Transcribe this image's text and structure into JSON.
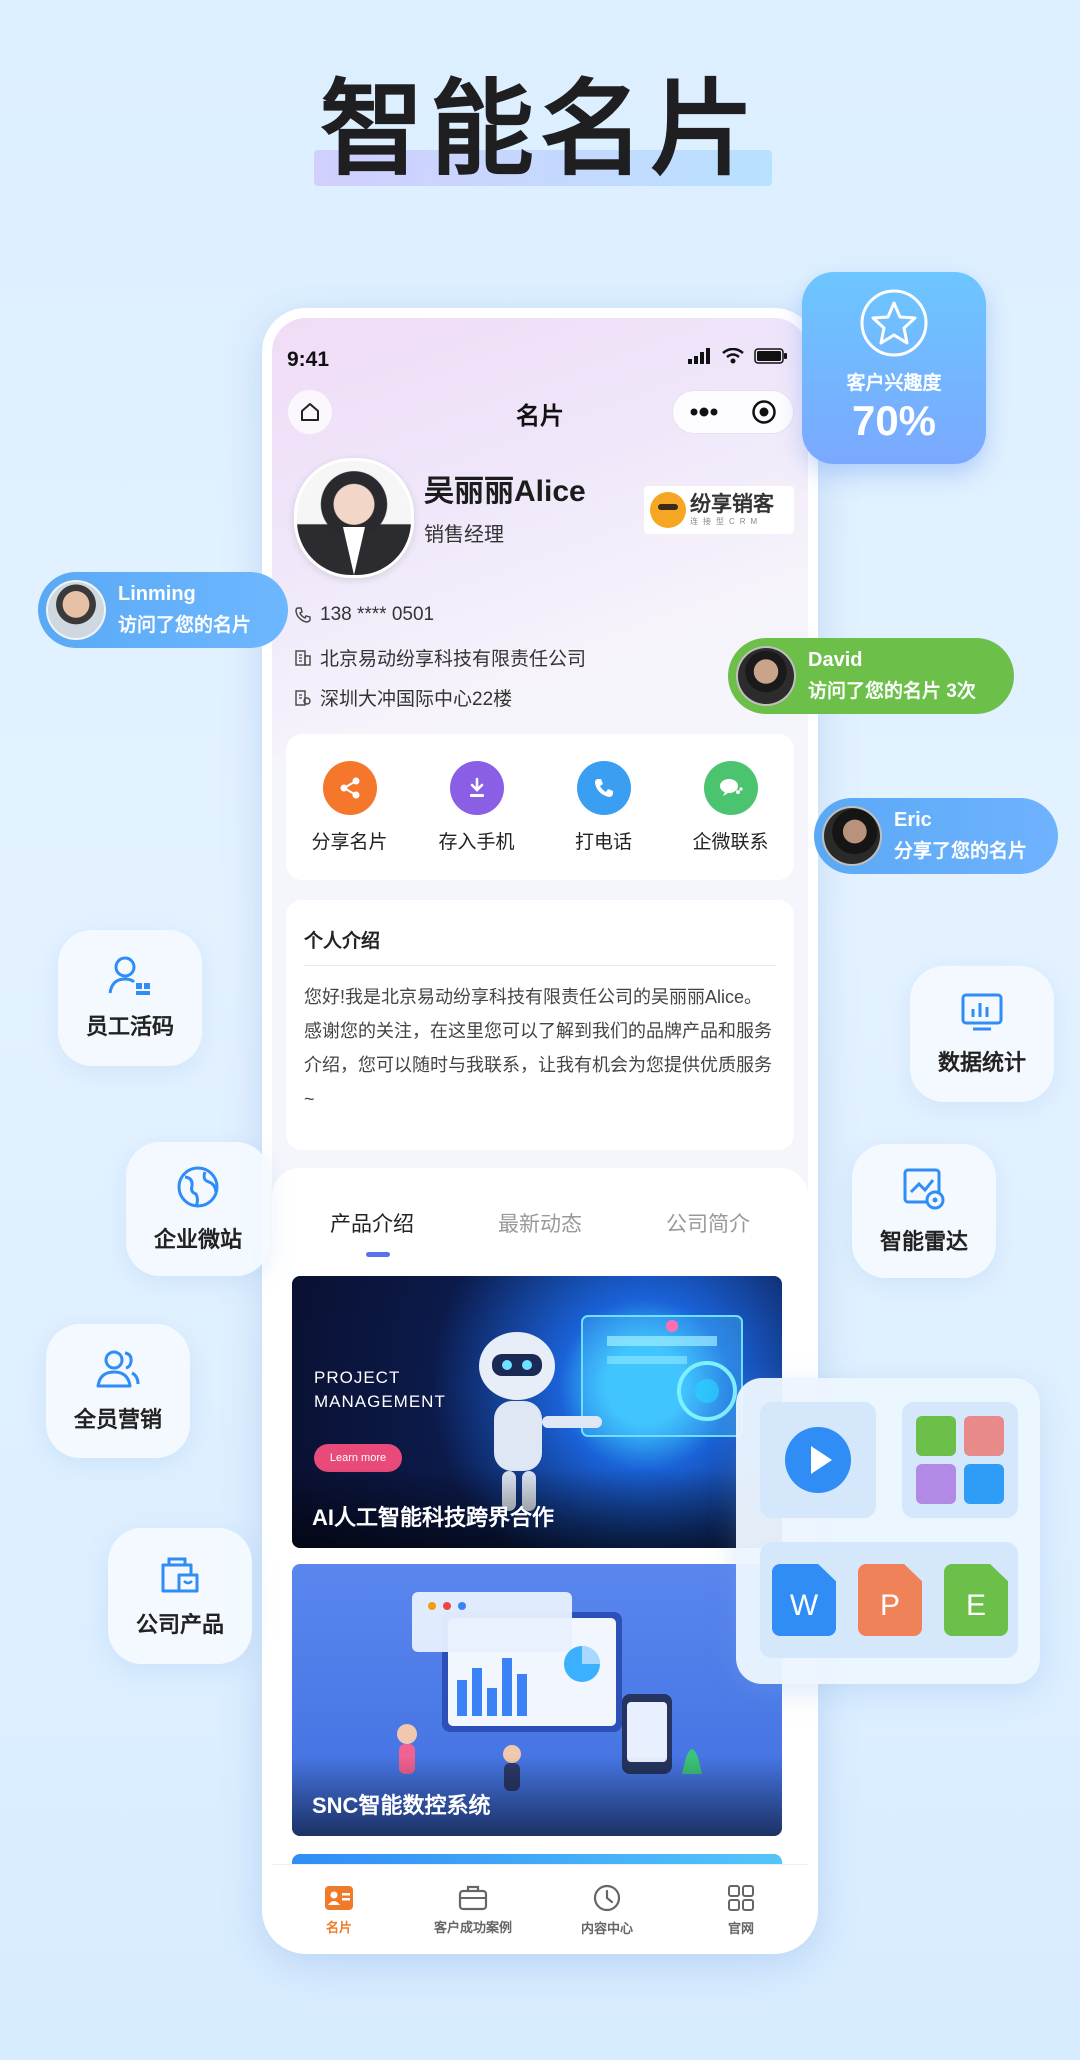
{
  "headline": "智能名片",
  "status": {
    "time": "9:41"
  },
  "nav": {
    "title": "名片"
  },
  "profile": {
    "name": "吴丽丽Alice",
    "role": "销售经理",
    "logo_text": "纷享销客",
    "logo_sub": "连接型CRM",
    "phone": "138 **** 0501",
    "company": "北京易动纷享科技有限责任公司",
    "address": "深圳大冲国际中心22楼"
  },
  "actions": [
    {
      "label": "分享名片",
      "color": "#f5772c",
      "icon": "share-icon"
    },
    {
      "label": "存入手机",
      "color": "#8a5fe6",
      "icon": "download-icon"
    },
    {
      "label": "打电话",
      "color": "#3a9ff0",
      "icon": "phone-icon"
    },
    {
      "label": "企微联系",
      "color": "#4cc46f",
      "icon": "wecom-icon"
    }
  ],
  "intro": {
    "title": "个人介绍",
    "body": "您好!我是北京易动纷享科技有限责任公司的吴丽丽Alice。感谢您的关注，在这里您可以了解到我们的品牌产品和服务介绍，您可以随时与我联系，让我有机会为您提供优质服务~"
  },
  "tabs": [
    "产品介绍",
    "最新动态",
    "公司简介"
  ],
  "banners": [
    {
      "title": "AI人工智能科技跨界合作",
      "overlay": "PROJECT MANAGEMENT",
      "button": "Learn more"
    },
    {
      "title": "SNC智能数控系统"
    }
  ],
  "bottom_nav": [
    {
      "label": "名片",
      "icon": "card-icon",
      "active": true
    },
    {
      "label": "客户成功案例",
      "icon": "briefcase-icon",
      "active": false
    },
    {
      "label": "内容中心",
      "icon": "clock-icon",
      "active": false
    },
    {
      "label": "官网",
      "icon": "grid-icon",
      "active": false
    }
  ],
  "interest": {
    "label": "客户兴趣度",
    "value": "70%"
  },
  "notifications": [
    {
      "name": "Linming",
      "message": "访问了您的名片"
    },
    {
      "name": "David",
      "message": "访问了您的名片 3次"
    },
    {
      "name": "Eric",
      "message": "分享了您的名片"
    }
  ],
  "features": [
    {
      "label": "员工活码",
      "icon": "person-code-icon"
    },
    {
      "label": "数据统计",
      "icon": "monitor-chart-icon"
    },
    {
      "label": "企业微站",
      "icon": "globe-icon"
    },
    {
      "label": "智能雷达",
      "icon": "radar-icon"
    },
    {
      "label": "全员营销",
      "icon": "group-icon"
    },
    {
      "label": "公司产品",
      "icon": "bag-icon"
    }
  ],
  "files": [
    "W",
    "P",
    "E"
  ],
  "colors": {
    "accent_blue": "#3a9ff0",
    "active_orange": "#ef7a2a",
    "green_pill": "#6cc04a"
  }
}
